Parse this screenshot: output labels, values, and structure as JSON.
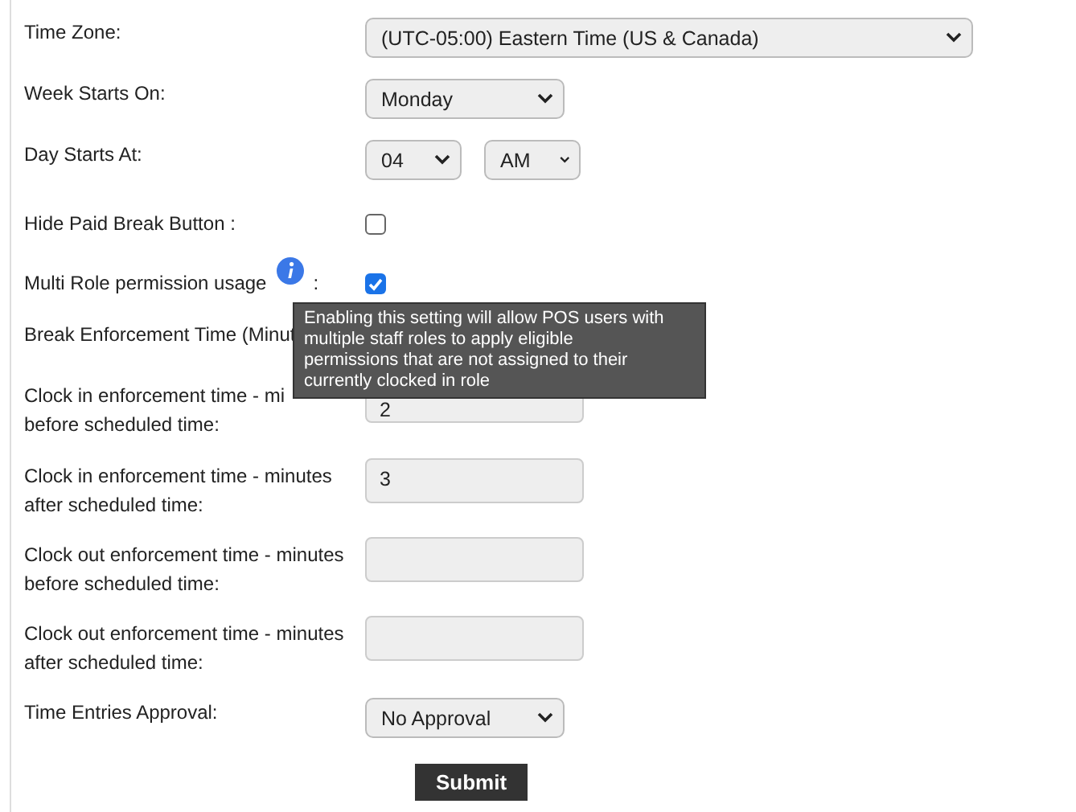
{
  "fields": [
    {
      "kind": "wideselect",
      "label": "Time Zone:",
      "value": "(UTC-05:00) Eastern Time (US & Canada)"
    },
    {
      "kind": "select",
      "label": "Week Starts On:",
      "value": "Monday"
    },
    {
      "kind": "time",
      "label": "Day Starts At:",
      "hour": "04",
      "period": "AM"
    },
    {
      "kind": "checkbox",
      "label": "Hide Paid Break Button :",
      "checked": false
    },
    {
      "kind": "checkbox-info",
      "label": "Multi Role permission usage",
      "suffix": ":",
      "checked": true
    },
    {
      "kind": "label-only",
      "label": "Break Enforcement Time (Minut"
    },
    {
      "kind": "text",
      "label": "Clock in enforcement time - mi",
      "label_2": "before scheduled time:",
      "value": "2"
    },
    {
      "kind": "text",
      "label": "Clock in enforcement time - minutes after scheduled time:",
      "value": "3"
    },
    {
      "kind": "text",
      "label": "Clock out enforcement time - minutes before scheduled time:"
    },
    {
      "kind": "text",
      "label": "Clock out enforcement time - minutes after scheduled time:"
    },
    {
      "kind": "select",
      "label": "Time Entries Approval:",
      "value": "No Approval"
    }
  ],
  "tooltip": "Enabling this setting will allow POS users with multiple staff roles to apply eligible permissions that are not assigned to their currently clocked in role",
  "submit": "Submit"
}
